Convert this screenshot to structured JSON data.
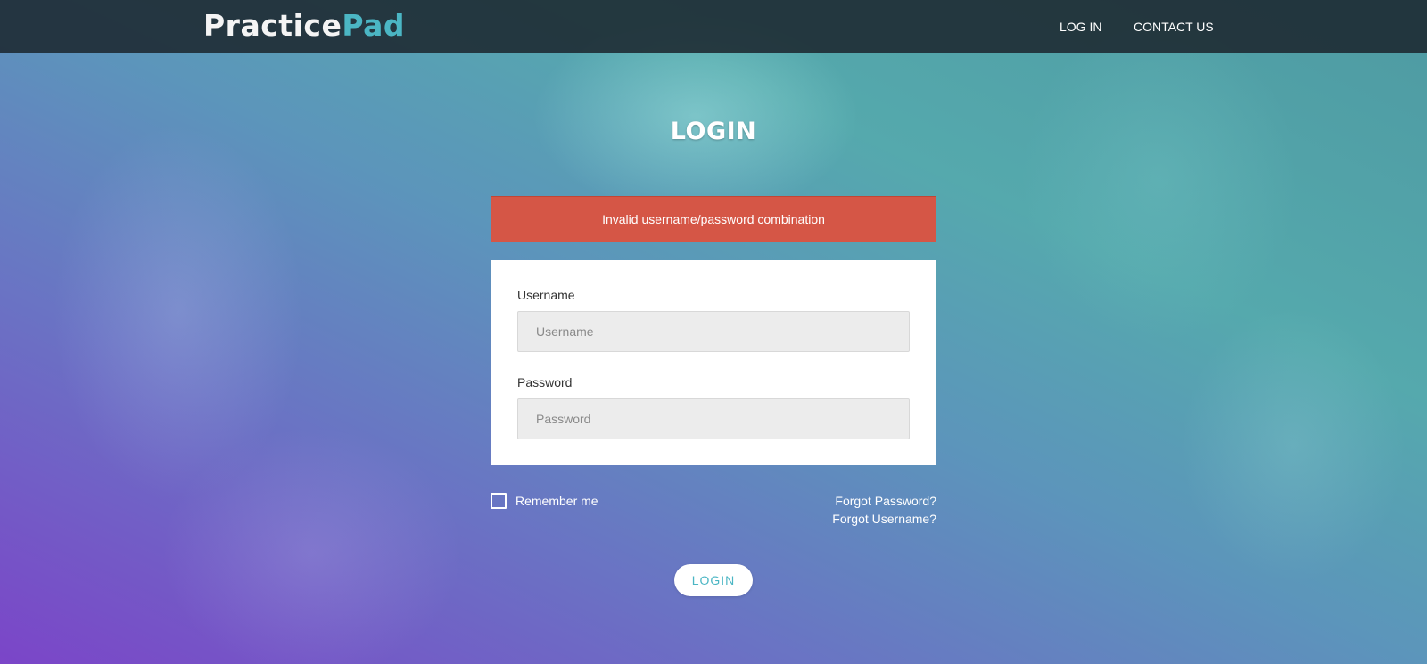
{
  "header": {
    "brand_part1": "Practice",
    "brand_part2": "Pad",
    "nav": {
      "login": "LOG IN",
      "contact": "CONTACT US"
    }
  },
  "page": {
    "title": "LOGIN"
  },
  "alert": {
    "message": "Invalid username/password combination"
  },
  "form": {
    "username_label": "Username",
    "username_placeholder": "Username",
    "username_value": "",
    "password_label": "Password",
    "password_placeholder": "Password",
    "password_value": "",
    "remember_label": "Remember me",
    "remember_checked": false,
    "forgot_password": "Forgot Password?",
    "forgot_username": "Forgot Username?",
    "submit_label": "LOGIN"
  },
  "colors": {
    "accent": "#4bb6c4",
    "error": "#d55646",
    "navbar": "#1c2830"
  },
  "icons": {
    "remember_checkbox": "checkbox-unchecked-icon"
  }
}
